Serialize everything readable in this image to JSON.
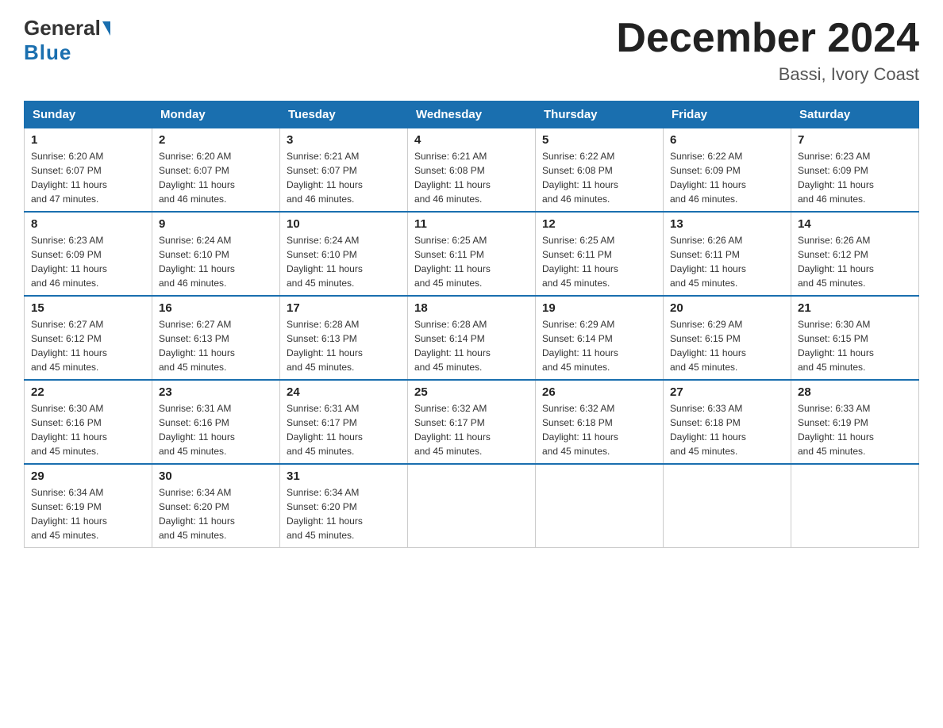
{
  "header": {
    "logo_general": "General",
    "logo_blue": "Blue",
    "month_title": "December 2024",
    "location": "Bassi, Ivory Coast"
  },
  "days_of_week": [
    "Sunday",
    "Monday",
    "Tuesday",
    "Wednesday",
    "Thursday",
    "Friday",
    "Saturday"
  ],
  "weeks": [
    [
      {
        "day": "1",
        "sunrise": "6:20 AM",
        "sunset": "6:07 PM",
        "daylight": "11 hours and 47 minutes."
      },
      {
        "day": "2",
        "sunrise": "6:20 AM",
        "sunset": "6:07 PM",
        "daylight": "11 hours and 46 minutes."
      },
      {
        "day": "3",
        "sunrise": "6:21 AM",
        "sunset": "6:07 PM",
        "daylight": "11 hours and 46 minutes."
      },
      {
        "day": "4",
        "sunrise": "6:21 AM",
        "sunset": "6:08 PM",
        "daylight": "11 hours and 46 minutes."
      },
      {
        "day": "5",
        "sunrise": "6:22 AM",
        "sunset": "6:08 PM",
        "daylight": "11 hours and 46 minutes."
      },
      {
        "day": "6",
        "sunrise": "6:22 AM",
        "sunset": "6:09 PM",
        "daylight": "11 hours and 46 minutes."
      },
      {
        "day": "7",
        "sunrise": "6:23 AM",
        "sunset": "6:09 PM",
        "daylight": "11 hours and 46 minutes."
      }
    ],
    [
      {
        "day": "8",
        "sunrise": "6:23 AM",
        "sunset": "6:09 PM",
        "daylight": "11 hours and 46 minutes."
      },
      {
        "day": "9",
        "sunrise": "6:24 AM",
        "sunset": "6:10 PM",
        "daylight": "11 hours and 46 minutes."
      },
      {
        "day": "10",
        "sunrise": "6:24 AM",
        "sunset": "6:10 PM",
        "daylight": "11 hours and 45 minutes."
      },
      {
        "day": "11",
        "sunrise": "6:25 AM",
        "sunset": "6:11 PM",
        "daylight": "11 hours and 45 minutes."
      },
      {
        "day": "12",
        "sunrise": "6:25 AM",
        "sunset": "6:11 PM",
        "daylight": "11 hours and 45 minutes."
      },
      {
        "day": "13",
        "sunrise": "6:26 AM",
        "sunset": "6:11 PM",
        "daylight": "11 hours and 45 minutes."
      },
      {
        "day": "14",
        "sunrise": "6:26 AM",
        "sunset": "6:12 PM",
        "daylight": "11 hours and 45 minutes."
      }
    ],
    [
      {
        "day": "15",
        "sunrise": "6:27 AM",
        "sunset": "6:12 PM",
        "daylight": "11 hours and 45 minutes."
      },
      {
        "day": "16",
        "sunrise": "6:27 AM",
        "sunset": "6:13 PM",
        "daylight": "11 hours and 45 minutes."
      },
      {
        "day": "17",
        "sunrise": "6:28 AM",
        "sunset": "6:13 PM",
        "daylight": "11 hours and 45 minutes."
      },
      {
        "day": "18",
        "sunrise": "6:28 AM",
        "sunset": "6:14 PM",
        "daylight": "11 hours and 45 minutes."
      },
      {
        "day": "19",
        "sunrise": "6:29 AM",
        "sunset": "6:14 PM",
        "daylight": "11 hours and 45 minutes."
      },
      {
        "day": "20",
        "sunrise": "6:29 AM",
        "sunset": "6:15 PM",
        "daylight": "11 hours and 45 minutes."
      },
      {
        "day": "21",
        "sunrise": "6:30 AM",
        "sunset": "6:15 PM",
        "daylight": "11 hours and 45 minutes."
      }
    ],
    [
      {
        "day": "22",
        "sunrise": "6:30 AM",
        "sunset": "6:16 PM",
        "daylight": "11 hours and 45 minutes."
      },
      {
        "day": "23",
        "sunrise": "6:31 AM",
        "sunset": "6:16 PM",
        "daylight": "11 hours and 45 minutes."
      },
      {
        "day": "24",
        "sunrise": "6:31 AM",
        "sunset": "6:17 PM",
        "daylight": "11 hours and 45 minutes."
      },
      {
        "day": "25",
        "sunrise": "6:32 AM",
        "sunset": "6:17 PM",
        "daylight": "11 hours and 45 minutes."
      },
      {
        "day": "26",
        "sunrise": "6:32 AM",
        "sunset": "6:18 PM",
        "daylight": "11 hours and 45 minutes."
      },
      {
        "day": "27",
        "sunrise": "6:33 AM",
        "sunset": "6:18 PM",
        "daylight": "11 hours and 45 minutes."
      },
      {
        "day": "28",
        "sunrise": "6:33 AM",
        "sunset": "6:19 PM",
        "daylight": "11 hours and 45 minutes."
      }
    ],
    [
      {
        "day": "29",
        "sunrise": "6:34 AM",
        "sunset": "6:19 PM",
        "daylight": "11 hours and 45 minutes."
      },
      {
        "day": "30",
        "sunrise": "6:34 AM",
        "sunset": "6:20 PM",
        "daylight": "11 hours and 45 minutes."
      },
      {
        "day": "31",
        "sunrise": "6:34 AM",
        "sunset": "6:20 PM",
        "daylight": "11 hours and 45 minutes."
      },
      null,
      null,
      null,
      null
    ]
  ],
  "labels": {
    "sunrise": "Sunrise:",
    "sunset": "Sunset:",
    "daylight": "Daylight:"
  }
}
